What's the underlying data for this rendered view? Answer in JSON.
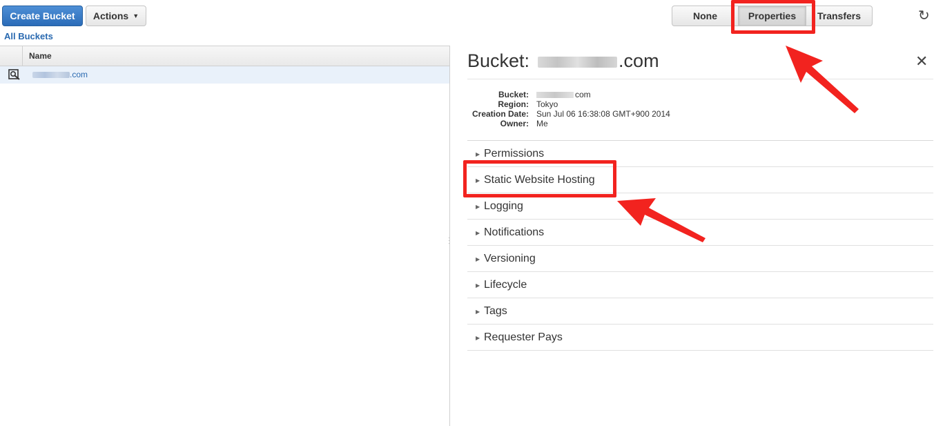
{
  "toolbar": {
    "create_label": "Create Bucket",
    "actions_label": "Actions",
    "view_none": "None",
    "view_properties": "Properties",
    "view_transfers": "Transfers",
    "refresh_icon": "refresh-icon"
  },
  "breadcrumb": {
    "all_buckets": "All Buckets"
  },
  "table": {
    "header_name": "Name",
    "rows": [
      {
        "name_suffix": ".com",
        "icon": "bucket-magnifier-icon"
      }
    ]
  },
  "details": {
    "title_prefix": "Bucket:",
    "title_suffix": ".com",
    "close_icon": "close-icon",
    "info": {
      "bucket_label": "Bucket:",
      "bucket_suffix": "com",
      "region_label": "Region:",
      "region_value": "Tokyo",
      "creation_label": "Creation Date:",
      "creation_value": "Sun Jul 06 16:38:08 GMT+900 2014",
      "owner_label": "Owner:",
      "owner_value": "Me"
    },
    "sections": [
      "Permissions",
      "Static Website Hosting",
      "Logging",
      "Notifications",
      "Versioning",
      "Lifecycle",
      "Tags",
      "Requester Pays"
    ]
  },
  "colors": {
    "primary_button": "#2b6cb8",
    "link": "#2969b0",
    "annotation": "#f2231f",
    "selected_row": "#e9f1fa"
  }
}
